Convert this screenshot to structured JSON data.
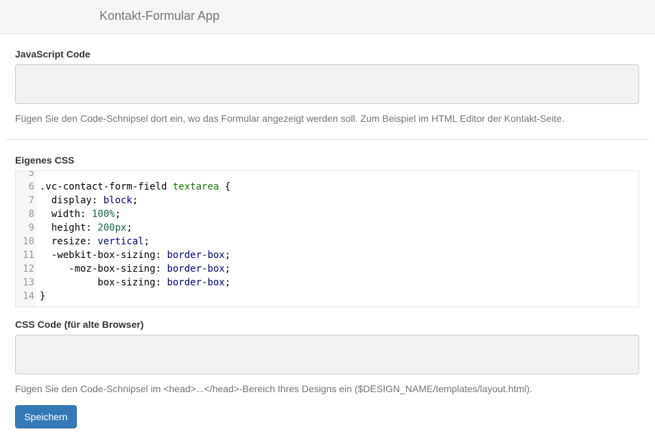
{
  "app": {
    "title": "Kontakt-Formular App"
  },
  "js_section": {
    "label": "JavaScript Code",
    "value": "",
    "help": "Fügen Sie den Code-Schnipsel dort ein, wo das Formular angezeigt werden soll. Zum Beispiel im HTML Editor der Kontakt-Seite."
  },
  "css_section": {
    "label": "Eigenes CSS",
    "lines": [
      {
        "num": "5",
        "tokens": []
      },
      {
        "num": "6",
        "tokens": [
          {
            "t": ".vc-contact-form-field ",
            "c": ""
          },
          {
            "t": "textarea",
            "c": "tag"
          },
          {
            "t": " {",
            "c": ""
          }
        ]
      },
      {
        "num": "7",
        "tokens": [
          {
            "t": "  display: ",
            "c": ""
          },
          {
            "t": "block",
            "c": "kw"
          },
          {
            "t": ";",
            "c": ""
          }
        ]
      },
      {
        "num": "8",
        "tokens": [
          {
            "t": "  width: ",
            "c": ""
          },
          {
            "t": "100%",
            "c": "num"
          },
          {
            "t": ";",
            "c": ""
          }
        ]
      },
      {
        "num": "9",
        "tokens": [
          {
            "t": "  height: ",
            "c": ""
          },
          {
            "t": "200px",
            "c": "num"
          },
          {
            "t": ";",
            "c": ""
          }
        ]
      },
      {
        "num": "10",
        "tokens": [
          {
            "t": "  resize: ",
            "c": ""
          },
          {
            "t": "vertical",
            "c": "kw"
          },
          {
            "t": ";",
            "c": ""
          }
        ]
      },
      {
        "num": "11",
        "tokens": [
          {
            "t": "  -webkit-box-sizing: ",
            "c": ""
          },
          {
            "t": "border-box",
            "c": "kw"
          },
          {
            "t": ";",
            "c": ""
          }
        ]
      },
      {
        "num": "12",
        "tokens": [
          {
            "t": "     -moz-box-sizing: ",
            "c": ""
          },
          {
            "t": "border-box",
            "c": "kw"
          },
          {
            "t": ";",
            "c": ""
          }
        ]
      },
      {
        "num": "13",
        "tokens": [
          {
            "t": "          box-sizing: ",
            "c": ""
          },
          {
            "t": "border-box",
            "c": "kw"
          },
          {
            "t": ";",
            "c": ""
          }
        ]
      },
      {
        "num": "14",
        "tokens": [
          {
            "t": "}",
            "c": ""
          }
        ]
      }
    ]
  },
  "legacy_section": {
    "label": "CSS Code (für alte Browser)",
    "value": "",
    "help": "Fügen Sie den Code-Schnipsel im <head>...</head>-Bereich Ihres Designs ein ($DESIGN_NAME/templates/layout.html)."
  },
  "actions": {
    "save_label": "Speichern"
  },
  "colors": {
    "primary": "#337ab7",
    "editor_keyword": "#000080",
    "editor_number": "#116644",
    "editor_tag": "#117700"
  }
}
